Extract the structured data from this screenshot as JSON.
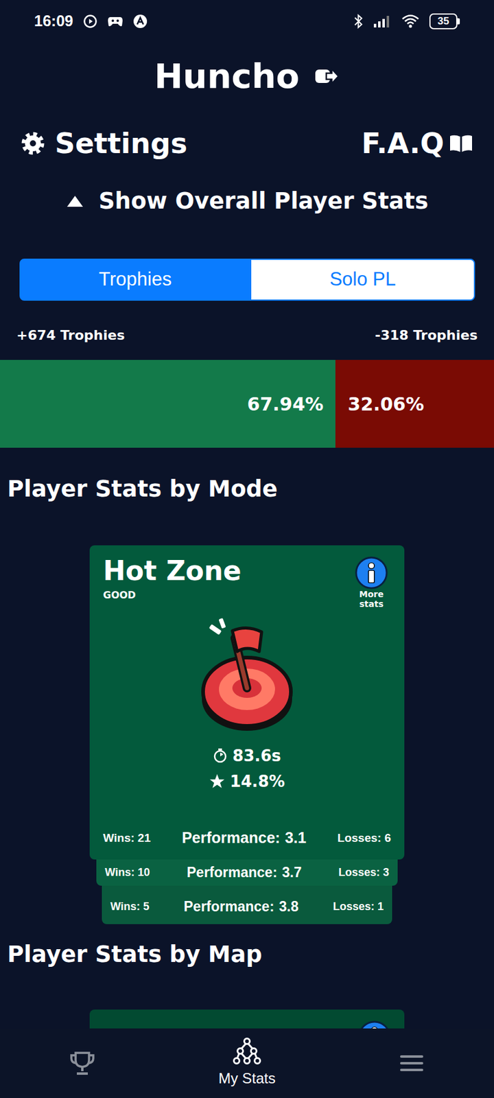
{
  "status_bar": {
    "time": "16:09",
    "battery": "35"
  },
  "header": {
    "title": "Huncho"
  },
  "links": {
    "settings": "Settings",
    "faq": "F.A.Q"
  },
  "overall_toggle": {
    "label": "Show Overall Player Stats"
  },
  "tabs": [
    {
      "label": "Trophies",
      "selected": true
    },
    {
      "label": "Solo PL",
      "selected": false
    }
  ],
  "trophy_bar": {
    "gained": "+674 Trophies",
    "lost": "-318 Trophies",
    "segments": [
      {
        "label": "67.94%",
        "level": 0.6794,
        "color": "#137a4a"
      },
      {
        "label": "32.06%",
        "level": 0.3206,
        "color": "#7a0b04"
      }
    ]
  },
  "mode_section": {
    "heading": "Player Stats by Mode",
    "cards": [
      {
        "title": "Hot Zone",
        "rating": "GOOD",
        "more": "More stats",
        "time": "83.6s",
        "star_rate": "14.8%",
        "rows": [
          {
            "wins": "Wins: 21",
            "performance_label": "Performance:",
            "performance": "3.1",
            "losses": "Losses: 6"
          },
          {
            "wins": "Wins: 10",
            "performance_label": "Performance:",
            "performance": "3.7",
            "losses": "Losses: 3"
          },
          {
            "wins": "Wins: 5",
            "performance_label": "Performance:",
            "performance": "3.8",
            "losses": "Losses: 1"
          }
        ]
      }
    ]
  },
  "map_section": {
    "heading": "Player Stats by Map"
  },
  "bottom_nav": [
    {
      "kind": "trophies",
      "selected": false
    },
    {
      "kind": "stats",
      "label": "My Stats",
      "selected": true
    },
    {
      "kind": "menu",
      "selected": false
    }
  ]
}
